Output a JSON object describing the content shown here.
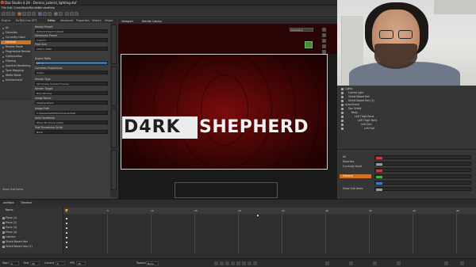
{
  "window": {
    "title": "Daz Studio 4.24 - Demos_Lateral_lighting.duf"
  },
  "menu": [
    "File",
    "Edit",
    "Create",
    "Tools",
    "Render",
    "Window",
    "Help"
  ],
  "left_pane": {
    "tabs": [
      "Engine",
      "NVIDIA Iray (RT)",
      "Editor",
      "Advanced",
      "Properties",
      "History",
      "Shape"
    ],
    "categories": [
      "All",
      "Favorites",
      "Currently Used",
      "General",
      "Render Mode",
      "Progressive Render",
      "Optimization",
      "Filtering",
      "Spectral Rendering",
      "Tone Mapping",
      "White Mode",
      "Environment"
    ],
    "selected_category": "General",
    "properties": [
      {
        "label": "Render Preset",
        "value": "Default Preset (Global)"
      },
      {
        "label": "Dimension Preset",
        "value": "Custom"
      },
      {
        "label": "Pixel Size",
        "value": "1920 x 1080"
      },
      {
        "label": "Aspect Ratio",
        "value": "16 : 9"
      },
      {
        "label": "Constrain Proportions",
        "value": "Active"
      },
      {
        "label": "Render Type",
        "value": "Still Image (Current Frame)"
      },
      {
        "label": "Render Target",
        "value": "New Window"
      },
      {
        "label": "Image Name",
        "value": "ShepherdDark"
      },
      {
        "label": "Image Path",
        "value": "C:/Users/Daz3D/Documents/DAZ"
      },
      {
        "label": "Auto Headlamp",
        "value": "When No Scene Lights"
      },
      {
        "label": "Post Processing Script",
        "value": "None"
      }
    ],
    "show_sub_items": "Show Sub Items"
  },
  "viewport": {
    "tabs": [
      "Viewport",
      "Render Library"
    ],
    "camera": "Camera 1",
    "logo_left": "D4RK",
    "logo_right": "SHEPHERD"
  },
  "scene": {
    "items": [
      "Lights",
      "Lateral Light",
      "Shield Based Hair",
      "Shield Based Hair (2)",
      "ActorShield",
      "Daz Shield",
      "Body",
      "Left Thigh Bend",
      "Left Thigh Twist",
      "Left Shin",
      "Left Foot"
    ]
  },
  "surfaces": {
    "categories": [
      "All",
      "Favorites",
      "Currently Used",
      "General",
      "Show Sub Items"
    ],
    "selected": "General",
    "swatch_colors": [
      "#c73c3c",
      "#9a9a9a",
      "#49b049",
      "#3c7ac7",
      "#9a9a9a",
      "#d4731f"
    ]
  },
  "timeline": {
    "tabs": [
      "aniMate",
      "Timeline"
    ],
    "rows": [
      "Plane (1)",
      "Plane (2)",
      "Plane (3)",
      "Plane (4)",
      "Camera",
      "Shield Based Hair",
      "Shield Based Hair (2)"
    ],
    "ticks": [
      "0",
      "5",
      "10",
      "15",
      "20",
      "25",
      "30",
      "35",
      "40",
      "45"
    ],
    "header_name": "Name"
  },
  "transport": {
    "start_label": "Start",
    "start": "0",
    "end_label": "End",
    "end": "30",
    "current_label": "Current",
    "current": "0",
    "fps_label": "FPS",
    "fps": "30",
    "tweens_label": "Tweens",
    "tweens": "None"
  },
  "colors": {
    "accent": "#d4731f",
    "panel": "#3c3c3c",
    "render_bg": "#5a0808"
  }
}
